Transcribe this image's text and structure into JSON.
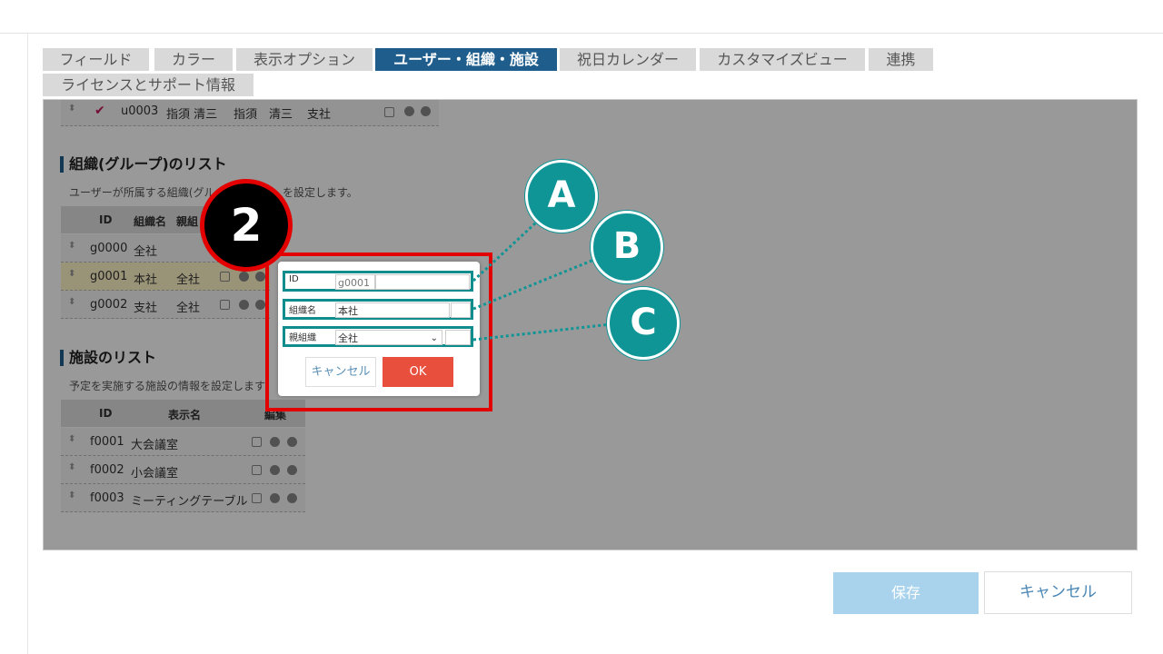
{
  "tabs": {
    "field": "フィールド",
    "color": "カラー",
    "display": "表示オプション",
    "users": "ユーザー・組織・施設",
    "holiday": "祝日カレンダー",
    "custom": "カスタマイズビュー",
    "link": "連携",
    "license": "ライセンスとサポート情報"
  },
  "userrow": {
    "id": "u0003",
    "name1": "指須 清三",
    "name2": "指須　清三",
    "org": "支社"
  },
  "org": {
    "title": "組織(グループ)のリスト",
    "desc_left": "ユーザーが所属する組織(グル",
    "desc_right": "を設定します。",
    "headers": {
      "id": "ID",
      "name": "組織名",
      "parent": "親組"
    },
    "rows": [
      {
        "id": "g0000",
        "name": "全社",
        "parent": ""
      },
      {
        "id": "g0001",
        "name": "本社",
        "parent": "全社"
      },
      {
        "id": "g0002",
        "name": "支社",
        "parent": "全社"
      }
    ]
  },
  "facility": {
    "title": "施設のリスト",
    "desc": "予定を実施する施設の情報を設定します",
    "headers": {
      "id": "ID",
      "name": "表示名",
      "edit": "編集"
    },
    "rows": [
      {
        "id": "f0001",
        "name": "大会議室"
      },
      {
        "id": "f0002",
        "name": "小会議室"
      },
      {
        "id": "f0003",
        "name": "ミーティングテーブル"
      }
    ]
  },
  "dialog": {
    "id_label": "ID",
    "id_value": "g0001",
    "name_label": "組織名",
    "name_value": "本社",
    "parent_label": "親組織",
    "parent_value": "全社",
    "cancel": "キャンセル",
    "ok": "OK"
  },
  "callouts": {
    "step": "2",
    "a": "A",
    "b": "B",
    "c": "C"
  },
  "footer": {
    "save": "保存",
    "cancel": "キャンセル"
  },
  "colors": {
    "accent": "#1f5e8c",
    "teal": "#0f9595",
    "red": "#e20000",
    "ok": "#e94f3d"
  }
}
